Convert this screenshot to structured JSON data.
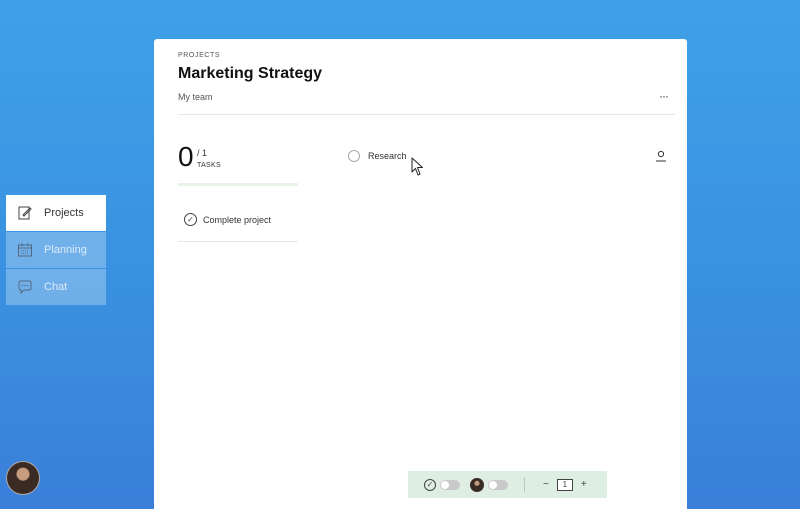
{
  "nav": {
    "items": [
      {
        "label": "Projects",
        "icon": "edit-note-icon",
        "active": true
      },
      {
        "label": "Planning",
        "icon": "calendar-icon",
        "active": false
      },
      {
        "label": "Chat",
        "icon": "chat-bubble-icon",
        "active": false
      }
    ]
  },
  "user": {
    "avatar": "user-avatar"
  },
  "project": {
    "eyebrow": "PROJECTS",
    "title": "Marketing Strategy",
    "team": "My team",
    "more_label": "···"
  },
  "tasks_summary": {
    "done": "0",
    "total": "/ 1",
    "label": "TASKS",
    "progress_fraction": 0
  },
  "filters": {
    "complete_label": "Complete project"
  },
  "task_list": [
    {
      "label": "Research",
      "done": false
    }
  ],
  "toolbar": {
    "minus_label": "−",
    "page": "1",
    "plus_label": "+"
  },
  "colors": {
    "background": "#3a8fe0",
    "progress_track": "#e6f3e6",
    "toolbar_bg": "#deeee2"
  }
}
